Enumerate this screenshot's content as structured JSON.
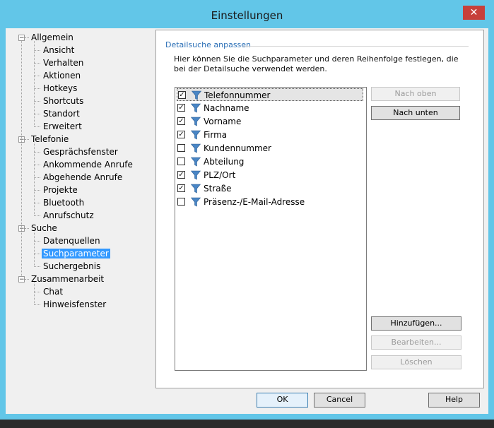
{
  "window": {
    "title": "Einstellungen",
    "close_symbol": "✕"
  },
  "tree": [
    {
      "label": "Allgemein",
      "level": 0,
      "expander": "−"
    },
    {
      "label": "Ansicht",
      "level": 1
    },
    {
      "label": "Verhalten",
      "level": 1
    },
    {
      "label": "Aktionen",
      "level": 1
    },
    {
      "label": "Hotkeys",
      "level": 1
    },
    {
      "label": "Shortcuts",
      "level": 1
    },
    {
      "label": "Standort",
      "level": 1
    },
    {
      "label": "Erweitert",
      "level": 1
    },
    {
      "label": "Telefonie",
      "level": 0,
      "expander": "−"
    },
    {
      "label": "Gesprächsfenster",
      "level": 1
    },
    {
      "label": "Ankommende Anrufe",
      "level": 1
    },
    {
      "label": "Abgehende Anrufe",
      "level": 1
    },
    {
      "label": "Projekte",
      "level": 1
    },
    {
      "label": "Bluetooth",
      "level": 1
    },
    {
      "label": "Anrufschutz",
      "level": 1
    },
    {
      "label": "Suche",
      "level": 0,
      "expander": "−"
    },
    {
      "label": "Datenquellen",
      "level": 1
    },
    {
      "label": "Suchparameter",
      "level": 1,
      "selected": true
    },
    {
      "label": "Suchergebnis",
      "level": 1
    },
    {
      "label": "Zusammenarbeit",
      "level": 0,
      "expander": "−"
    },
    {
      "label": "Chat",
      "level": 1
    },
    {
      "label": "Hinweisfenster",
      "level": 1
    }
  ],
  "panel": {
    "group_title": "Detailsuche anpassen",
    "description": "Hier können Sie die Suchparameter und deren Reihenfolge festlegen, die bei der Detailsuche verwendet werden.",
    "params": [
      {
        "label": "Telefonnummer",
        "checked": true,
        "selected": true
      },
      {
        "label": "Nachname",
        "checked": true
      },
      {
        "label": "Vorname",
        "checked": true
      },
      {
        "label": "Firma",
        "checked": true
      },
      {
        "label": "Kundennummer",
        "checked": false
      },
      {
        "label": "Abteilung",
        "checked": false
      },
      {
        "label": "PLZ/Ort",
        "checked": true
      },
      {
        "label": "Straße",
        "checked": true
      },
      {
        "label": "Präsenz-/E-Mail-Adresse",
        "checked": false
      }
    ],
    "buttons": {
      "up": "Nach oben",
      "down": "Nach unten",
      "add": "Hinzufügen...",
      "edit": "Bearbeiten...",
      "delete": "Löschen"
    }
  },
  "footer": {
    "ok": "OK",
    "cancel": "Cancel",
    "help": "Help"
  },
  "colors": {
    "titlebar": "#62c6e8",
    "accent": "#3399ff",
    "close": "#c7403a",
    "funnel": "#4a86c5"
  },
  "icons": {
    "param": "funnel-icon",
    "close": "close-icon"
  }
}
